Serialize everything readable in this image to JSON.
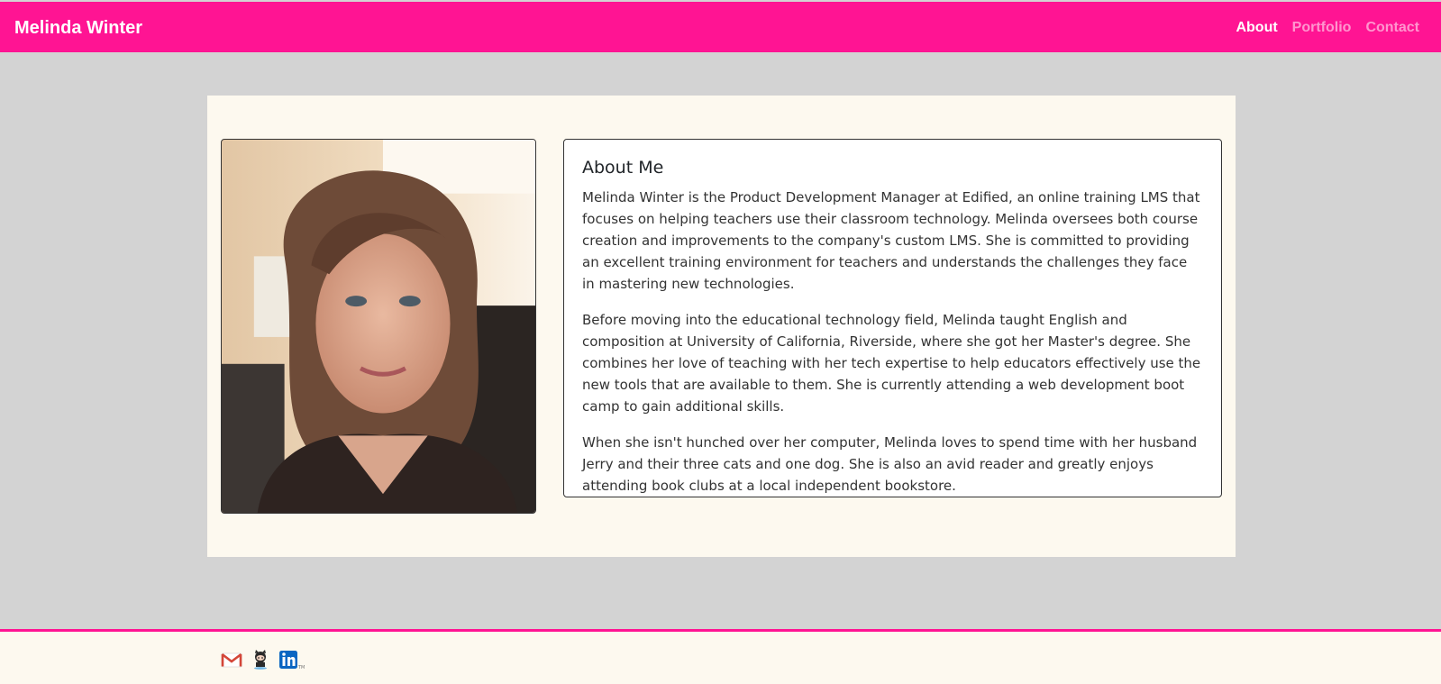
{
  "header": {
    "brand": "Melinda Winter",
    "nav": [
      {
        "label": "About",
        "active": true
      },
      {
        "label": "Portfolio",
        "active": false
      },
      {
        "label": "Contact",
        "active": false
      }
    ]
  },
  "about": {
    "title": "About Me",
    "paragraphs": [
      "Melinda Winter is the Product Development Manager at Edified, an online training LMS that focuses on helping teachers use their classroom technology. Melinda oversees both course creation and improvements to the company's custom LMS. She is committed to providing an excellent training environment for teachers and understands the challenges they face in mastering new technologies.",
      "Before moving into the educational technology field, Melinda taught English and composition at University of California, Riverside, where she got her Master's degree. She combines her love of teaching with her tech expertise to help educators effectively use the new tools that are available to them. She is currently attending a web development boot camp to gain additional skills.",
      "When she isn't hunched over her computer, Melinda loves to spend time with her husband Jerry and their three cats and one dog. She is also an avid reader and greatly enjoys attending book clubs at a local independent bookstore."
    ]
  },
  "footer": {
    "social": [
      {
        "icon": "gmail-icon"
      },
      {
        "icon": "github-icon"
      },
      {
        "icon": "linkedin-icon"
      }
    ]
  },
  "colors": {
    "accent": "#ff1493",
    "page_background": "#d3d3d3",
    "content_background": "#fdf9ef"
  }
}
